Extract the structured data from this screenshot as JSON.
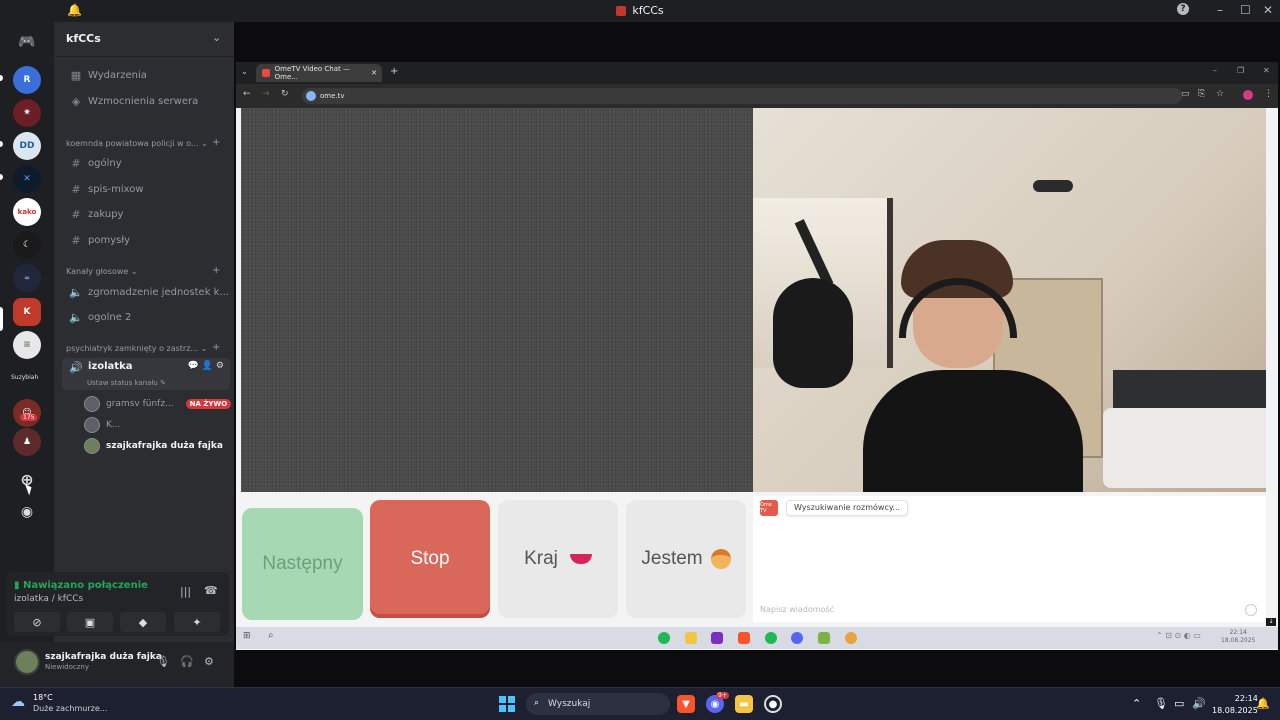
{
  "discord": {
    "window_title": "kfCCs",
    "server_name": "kfCCs",
    "top_items": [
      {
        "label": "Wydarzenia",
        "icon": "calendar-icon"
      },
      {
        "label": "Wzmocnienia serwera",
        "icon": "boost-icon"
      }
    ],
    "categories": [
      {
        "name": "koemnda powiatowa policji w o...",
        "channels": [
          {
            "label": "ogólny",
            "type": "text"
          },
          {
            "label": "spis-mixow",
            "type": "text"
          },
          {
            "label": "zakupy",
            "type": "text"
          },
          {
            "label": "pomysły",
            "type": "text"
          }
        ]
      },
      {
        "name": "Kanały głosowe",
        "channels": [
          {
            "label": "zgromadzenie jednostek k...",
            "type": "voice"
          },
          {
            "label": "ogolne 2",
            "type": "voice"
          }
        ]
      },
      {
        "name": "psychiatryk zamknięty o zastrz...",
        "channels": [
          {
            "label": "izolatka",
            "type": "voice",
            "active": true,
            "status": "Ustaw status kanału"
          }
        ]
      }
    ],
    "voice_users": [
      {
        "name": "gramsv fünfz...",
        "badge": "NA ŻYWO"
      },
      {
        "name": "K...",
        "badge": ""
      },
      {
        "name": "szajkafrajka duża fajka",
        "badge": ""
      }
    ],
    "guild_label": "Suzybiah",
    "guild_badge": "175",
    "voice_panel": {
      "status": "Nawiązano połączenie",
      "location": "izolatka / kfCCs"
    },
    "user": {
      "name": "szajkafrajka duża fajka",
      "status": "Niewidoczny"
    }
  },
  "browser": {
    "tab_title": "OmeTV Video Chat — Ome...",
    "url": "ome.tv"
  },
  "ometv": {
    "buttons": {
      "next": "Następny",
      "stop": "Stop",
      "country": "Kraj",
      "gender": "Jestem"
    },
    "chat_status": "Wyszukiwanie rozmówcy...",
    "chat_placeholder": "Napisz wiadomość",
    "logo_text": "Ome TV"
  },
  "inner_clock": {
    "time": "22:14",
    "date": "18.08.2025"
  },
  "taskbar": {
    "weather_temp": "18°C",
    "weather_desc": "Duże zachmurze...",
    "search_placeholder": "Wyszukaj",
    "discord_badge": "9+",
    "time": "22:14",
    "date": "18.08.2025"
  },
  "colors": {
    "discord_bg": "#1e1f22",
    "sidebar_bg": "#2b2d31",
    "connected_green": "#23a55a",
    "live_red": "#da373c",
    "ometv_next": "#a6d9b3",
    "ometv_stop": "#d9675a"
  }
}
